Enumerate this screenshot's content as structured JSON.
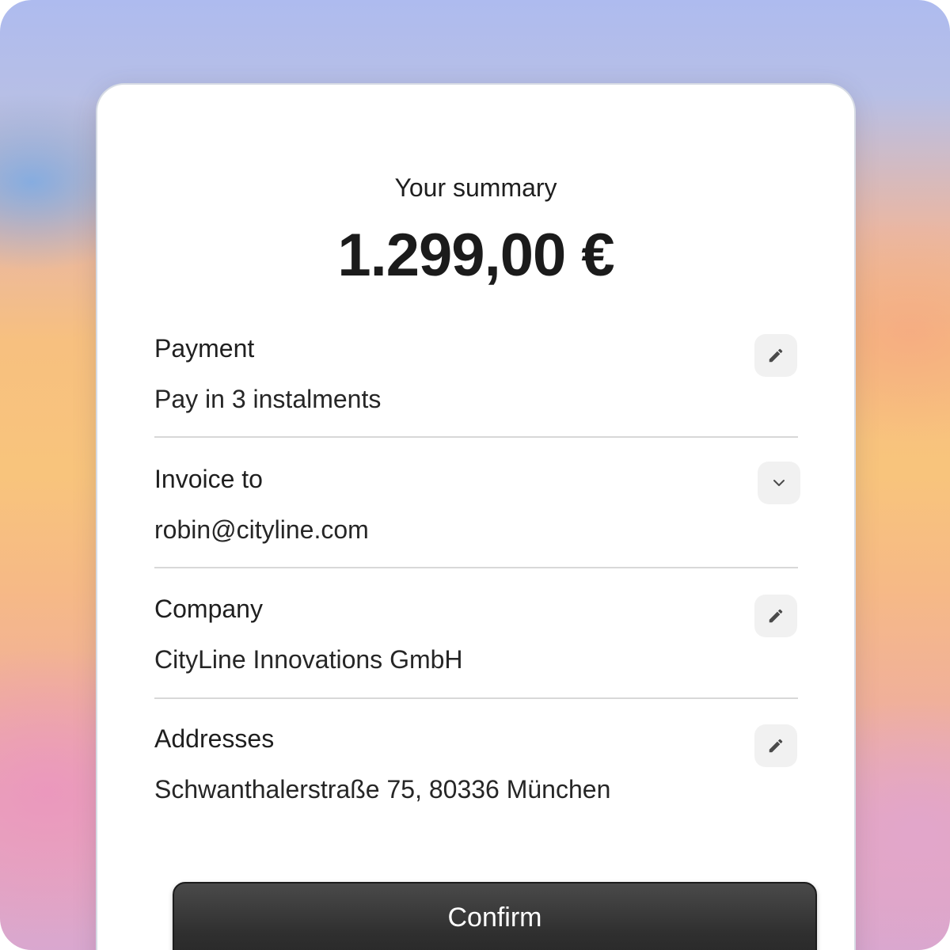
{
  "summary": {
    "label": "Your summary",
    "amount": "1.299,00 €"
  },
  "sections": [
    {
      "title": "Payment",
      "value": "Pay in 3 instalments",
      "action_icon": "pencil-icon"
    },
    {
      "title": "Invoice to",
      "value": "robin@cityline.com",
      "action_icon": "chevron-down-icon"
    },
    {
      "title": "Company",
      "value": "CityLine Innovations GmbH",
      "action_icon": "pencil-icon"
    },
    {
      "title": "Addresses",
      "value": "Schwanthalerstraße 75, 80336 München",
      "action_icon": "pencil-icon"
    }
  ],
  "confirm_button": {
    "label": "Confirm"
  },
  "colors": {
    "card_background": "#ffffff",
    "icon_button_background": "#f1f1f1",
    "confirm_button_background": "#2f2f2f",
    "text_primary": "#1f1f1f"
  }
}
